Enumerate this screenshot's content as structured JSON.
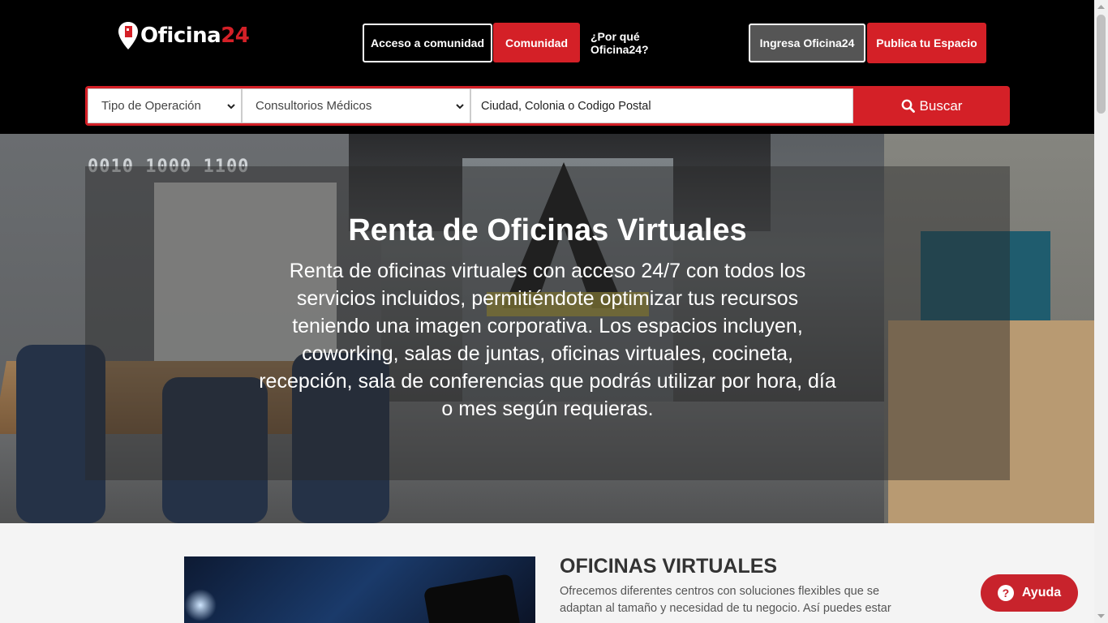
{
  "header": {
    "logo_text": "Oficina",
    "logo_num": "24",
    "nav": {
      "acceso": "Acceso a comunidad",
      "comunidad": "Comunidad",
      "porque": "¿Por qué Oficina24?",
      "ingresa": "Ingresa Oficina24",
      "publica": "Publica tu Espacio"
    }
  },
  "search": {
    "tipo_operacion": "Tipo de Operación",
    "tipo_espacio": "Consultorios Médicos",
    "placeholder": "Ciudad, Colonia o Codigo Postal",
    "button": "Buscar"
  },
  "hero": {
    "title": "Renta de Oficinas Virtuales",
    "text": "Renta de oficinas virtuales con acceso 24/7 con todos los servicios incluidos, permitiéndote optimizar tus recursos teniendo una imagen corporativa. Los espacios incluyen, coworking, salas de juntas, oficinas virtuales,  cocineta, recepción, sala de conferencias que podrás utilizar  por hora, día o mes según requieras.",
    "binary_label": "0010 1000 1100"
  },
  "section": {
    "title": "OFICINAS VIRTUALES",
    "text": "Ofrecemos diferentes centros con soluciones flexibles que se adaptan al tamaño y necesidad de tu negocio. Así puedes estar"
  },
  "help": {
    "label": "Ayuda"
  },
  "colors": {
    "brand_red": "#d42027",
    "header_bg": "#000000",
    "ingresa_bg": "#555555"
  }
}
